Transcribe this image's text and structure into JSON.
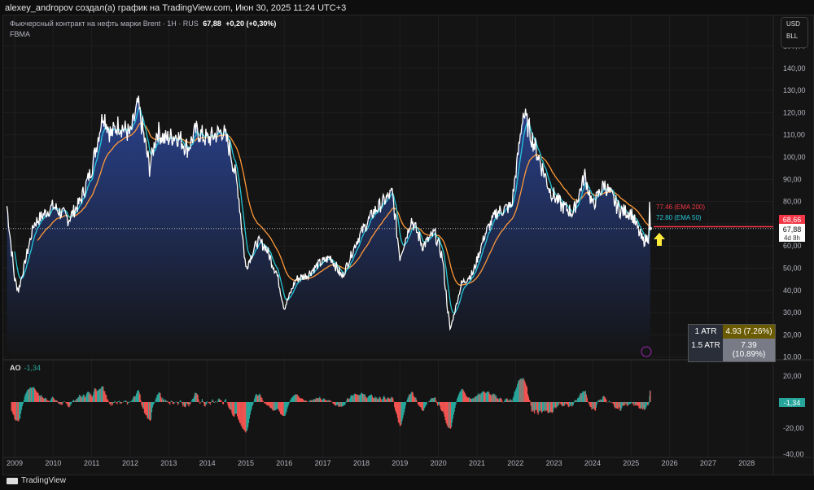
{
  "header": "alexey_andropov создал(а) график на TradingView.com, Июн 30, 2025 11:24 UTC+3",
  "legend": {
    "symbol": "Фьючерсный контракт на нефть марки Brent · 1H · RUS",
    "price": "67,88",
    "change": "+0,20 (+0,30%)",
    "indicator": "FBMA"
  },
  "currency": {
    "unit": "USD",
    "measure": "BLL"
  },
  "price_labels": {
    "current": "68,66",
    "last": "67,88",
    "countdown": "4d 8h",
    "ema200": "77.46 (EMA 200)",
    "ema50": "72.80 (EMA 50)"
  },
  "atr": [
    {
      "k": "1 ATR",
      "v": "4.93 (7.26%)"
    },
    {
      "k": "1.5 ATR",
      "v": "7.39 (10.89%)"
    }
  ],
  "ao": {
    "label": "AO",
    "value": "-1,34",
    "axis_label": "-1,34"
  },
  "footer": "TradingView",
  "colors": {
    "ema50": "#26c6da",
    "ema200": "#ff9838",
    "price": "#ffffff",
    "up": "#26a69a",
    "down": "#ef5350",
    "current": "#f23645"
  },
  "chart_data": {
    "type": "line",
    "price_axis": {
      "ticks": [
        150,
        140,
        130,
        120,
        110,
        100,
        90,
        80,
        70,
        60,
        50,
        40,
        30,
        20,
        10
      ],
      "range": [
        10,
        150
      ]
    },
    "ao_axis": {
      "ticks": [
        20,
        0,
        -20,
        -40
      ]
    },
    "x_ticks": [
      2009,
      2010,
      2011,
      2012,
      2013,
      2014,
      2015,
      2016,
      2017,
      2018,
      2019,
      2020,
      2021,
      2022,
      2023,
      2024,
      2025,
      2026,
      2027,
      2028
    ],
    "series": [
      {
        "name": "Brent",
        "points": [
          [
            2008.8,
            78
          ],
          [
            2009.0,
            45
          ],
          [
            2009.1,
            40
          ],
          [
            2009.3,
            55
          ],
          [
            2009.5,
            70
          ],
          [
            2009.8,
            75
          ],
          [
            2010.0,
            78
          ],
          [
            2010.4,
            72
          ],
          [
            2010.7,
            80
          ],
          [
            2011.0,
            95
          ],
          [
            2011.3,
            120
          ],
          [
            2011.5,
            110
          ],
          [
            2011.7,
            115
          ],
          [
            2012.0,
            110
          ],
          [
            2012.2,
            124
          ],
          [
            2012.5,
            95
          ],
          [
            2012.7,
            112
          ],
          [
            2012.9,
            108
          ],
          [
            2013.2,
            110
          ],
          [
            2013.5,
            104
          ],
          [
            2013.7,
            112
          ],
          [
            2014.0,
            108
          ],
          [
            2014.4,
            112
          ],
          [
            2014.6,
            103
          ],
          [
            2014.8,
            85
          ],
          [
            2015.0,
            50
          ],
          [
            2015.3,
            62
          ],
          [
            2015.5,
            60
          ],
          [
            2015.8,
            48
          ],
          [
            2016.0,
            32
          ],
          [
            2016.3,
            45
          ],
          [
            2016.6,
            47
          ],
          [
            2016.9,
            52
          ],
          [
            2017.2,
            55
          ],
          [
            2017.5,
            46
          ],
          [
            2017.9,
            63
          ],
          [
            2018.3,
            75
          ],
          [
            2018.8,
            84
          ],
          [
            2019.0,
            55
          ],
          [
            2019.3,
            72
          ],
          [
            2019.6,
            60
          ],
          [
            2019.9,
            66
          ],
          [
            2020.1,
            55
          ],
          [
            2020.3,
            22
          ],
          [
            2020.6,
            43
          ],
          [
            2020.9,
            48
          ],
          [
            2021.2,
            65
          ],
          [
            2021.5,
            75
          ],
          [
            2021.9,
            78
          ],
          [
            2022.2,
            120
          ],
          [
            2022.4,
            110
          ],
          [
            2022.7,
            95
          ],
          [
            2022.9,
            85
          ],
          [
            2023.2,
            78
          ],
          [
            2023.5,
            75
          ],
          [
            2023.8,
            92
          ],
          [
            2024.0,
            78
          ],
          [
            2024.3,
            88
          ],
          [
            2024.7,
            76
          ],
          [
            2025.0,
            75
          ],
          [
            2025.3,
            62
          ],
          [
            2025.45,
            64
          ],
          [
            2025.48,
            78
          ],
          [
            2025.5,
            67.88
          ]
        ]
      }
    ],
    "indicators": [
      "EMA 50",
      "EMA 200",
      "AO"
    ]
  }
}
